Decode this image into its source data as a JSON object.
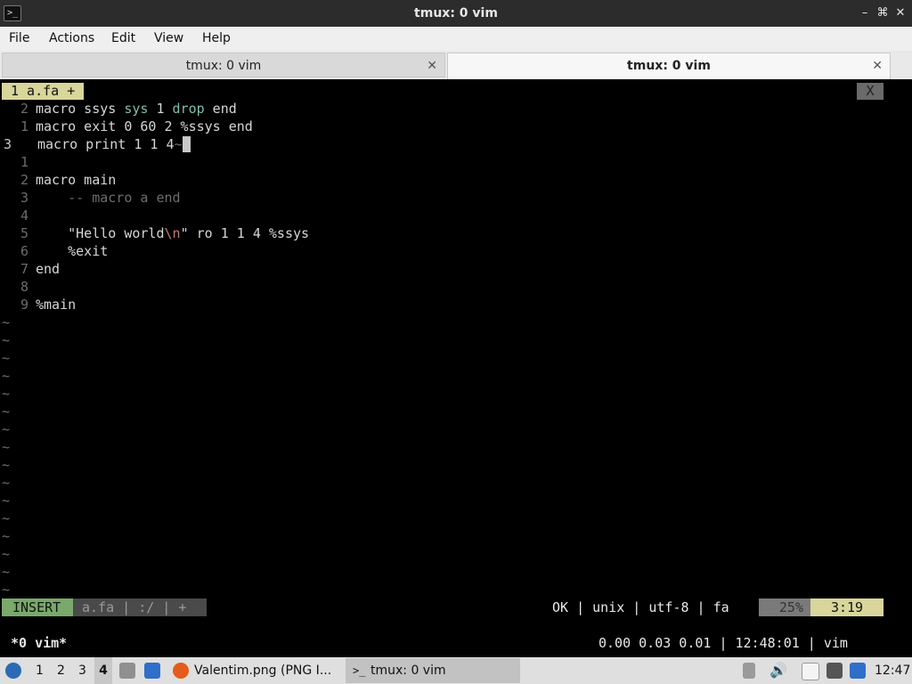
{
  "window": {
    "title": "tmux: 0 vim",
    "app_icon": "terminal-icon",
    "controls": [
      "–",
      "⌘",
      "✕"
    ]
  },
  "menubar": {
    "items": [
      "File",
      "Actions",
      "Edit",
      "View",
      "Help"
    ]
  },
  "tabs": [
    {
      "label": "tmux: 0 vim",
      "active": false
    },
    {
      "label": "tmux: 0 vim",
      "active": true
    }
  ],
  "vim": {
    "buffer_tab": "1 a.fa +",
    "buffer_close": "X",
    "lines": [
      {
        "num": "2",
        "tokens": [
          [
            "kw",
            "macro ssys "
          ],
          [
            "cy",
            "sys"
          ],
          [
            "kw",
            " 1 "
          ],
          [
            "cy",
            "drop"
          ],
          [
            "kw",
            " end"
          ]
        ]
      },
      {
        "num": "1",
        "tokens": [
          [
            "kw",
            "macro exit 0 60 2 %ssys end"
          ]
        ]
      },
      {
        "num": "3",
        "current": true,
        "tokens": [
          [
            "kw",
            "macro print 1 1 4"
          ],
          [
            "cm",
            "~"
          ],
          [
            "cursor",
            " "
          ]
        ]
      },
      {
        "num": "1",
        "tokens": []
      },
      {
        "num": "2",
        "tokens": [
          [
            "kw",
            "macro main"
          ]
        ]
      },
      {
        "num": "3",
        "tokens": [
          [
            "cm",
            "    -- macro a end"
          ]
        ]
      },
      {
        "num": "4",
        "tokens": []
      },
      {
        "num": "5",
        "tokens": [
          [
            "kw",
            "    \"Hello world"
          ],
          [
            "esc",
            "\\n"
          ],
          [
            "kw",
            "\" ro 1 1 4 %ssys"
          ]
        ]
      },
      {
        "num": "6",
        "tokens": [
          [
            "kw",
            "    %exit"
          ]
        ]
      },
      {
        "num": "7",
        "tokens": [
          [
            "kw",
            "end"
          ]
        ]
      },
      {
        "num": "8",
        "tokens": []
      },
      {
        "num": "9",
        "tokens": [
          [
            "kw",
            "%main"
          ]
        ]
      }
    ],
    "tilde_count": 16,
    "tilde_char": "~",
    "status": {
      "mode": "INSERT",
      "file_info": "a.fa | :/ | +",
      "right_info": "OK | unix | utf-8 | fa",
      "percent": "25%",
      "position": "3:19"
    },
    "colors": {
      "mode_bg": "#79a96b",
      "file_bg": "#4a4a4a",
      "percent_bg": "#7a7a7a",
      "pos_bg": "#d8d69a"
    }
  },
  "tmux": {
    "window_label": "*0 vim*",
    "status_right": "0.00 0.03 0.01 | 12:48:01 | vim"
  },
  "taskbar": {
    "workspaces": [
      "1",
      "2",
      "3",
      "4"
    ],
    "active_workspace": "4",
    "tasks": [
      {
        "label": "Valentim.png (PNG I...",
        "icon": "firefox-icon"
      },
      {
        "label": "tmux: 0 vim",
        "icon": "terminal-icon",
        "active": true
      }
    ],
    "clock": "12:47"
  }
}
